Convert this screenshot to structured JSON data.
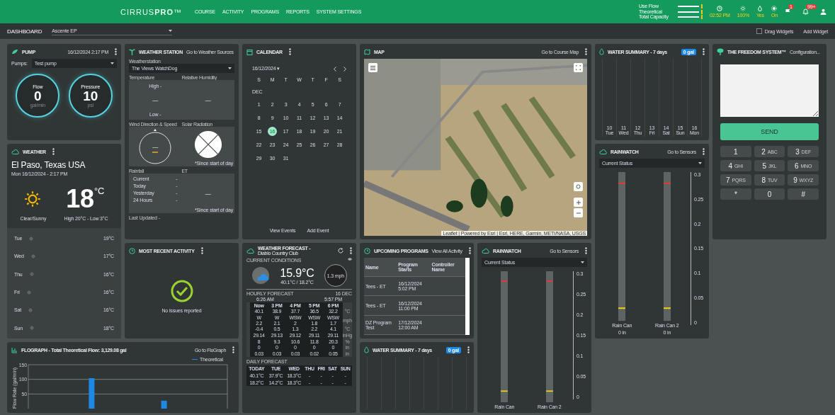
{
  "top_bar": {
    "logo": "CIRRUS**PRO**™",
    "nav": [
      "COURSE",
      "ACTIVITY",
      "PROGRAMS",
      "REPORTS",
      "SYSTEM SETTINGS"
    ],
    "flow_legend": [
      "Use Flow",
      "Theoretical",
      "Total Capacity"
    ],
    "status": [
      {
        "kind": "clock",
        "value": "02:52 PM"
      },
      {
        "kind": "sun",
        "value": "100%"
      },
      {
        "kind": "drop",
        "value": "Yes"
      },
      {
        "kind": "sprinkler",
        "value": "On"
      }
    ],
    "notifications": [
      {
        "kind": "flag",
        "badge": "1"
      },
      {
        "kind": "bell",
        "badge": "99+"
      }
    ]
  },
  "dashboard_bar": {
    "title": "DASHBOARD",
    "site": "Ascente EP",
    "drag_widgets": {
      "label": "Drag Widgets",
      "checked": false
    },
    "add_widget": "Add Widget"
  },
  "pump": {
    "title": "PUMP",
    "timestamp": "16/12/2024 2:17 PM",
    "pumps_label": "Pumps:",
    "pump": "Test pump",
    "gauges": [
      {
        "label": "Flow",
        "value": "0",
        "unit": "gal/min"
      },
      {
        "label": "Pressure",
        "value": "10",
        "unit": "psi"
      }
    ]
  },
  "weather": {
    "title": "WEATHER",
    "city": "El Paso, Texas USA",
    "date": "Mon 16/12/2024 - 2:17 PM",
    "temperature": "18",
    "unit": "°C",
    "condition": "Clear/Sunny",
    "high_low": "High 20°C - Low 3°C",
    "forecast": [
      {
        "day": "Tue",
        "temp": "19°C"
      },
      {
        "day": "Wed",
        "temp": "17°C"
      },
      {
        "day": "Thu",
        "temp": "16°C"
      },
      {
        "day": "Fri",
        "temp": "16°C"
      },
      {
        "day": "Sat",
        "temp": "16°C"
      },
      {
        "day": "Sun",
        "temp": "18°C"
      }
    ]
  },
  "weather_station": {
    "title": "WEATHER STATION",
    "link": "Go to Weather Sources",
    "station_label": "Weatherstation",
    "station": "The Views WatchDog",
    "temperature_label": "Temperature",
    "humidity_label": "Relative Humidity",
    "high": "High -",
    "low": "Low -",
    "temperature": "—",
    "humidity": "—",
    "wind_label": "Wind Direction & Speed",
    "solar_label": "Solar Radiation",
    "wind": "—",
    "solar_note": "*Since start of day",
    "rainfall_label": "Rainfall",
    "et_label": "ET",
    "rainfall": [
      {
        "label": "Current",
        "value": "-"
      },
      {
        "label": "Today",
        "value": "-"
      },
      {
        "label": "Yesterday",
        "value": "-"
      },
      {
        "label": "24 Hours",
        "value": "-"
      }
    ],
    "et": "—",
    "et_note": "*Since start of day",
    "last_updated": "Last Updated -"
  },
  "calendar": {
    "title": "CALENDAR",
    "date": "16/12/2024 ▾",
    "weekdays": [
      "S",
      "M",
      "T",
      "W",
      "T",
      "F",
      "S"
    ],
    "month": "DEC",
    "days": [
      {
        "label": "1",
        "selected": false
      },
      {
        "label": "2",
        "selected": false
      },
      {
        "label": "3",
        "selected": false
      },
      {
        "label": "4",
        "selected": false
      },
      {
        "label": "5",
        "selected": false
      },
      {
        "label": "6",
        "selected": false
      },
      {
        "label": "7",
        "selected": false
      },
      {
        "label": "8",
        "selected": false
      },
      {
        "label": "9",
        "selected": false
      },
      {
        "label": "10",
        "selected": false
      },
      {
        "label": "11",
        "selected": false
      },
      {
        "label": "12",
        "selected": false
      },
      {
        "label": "13",
        "selected": false
      },
      {
        "label": "14",
        "selected": false
      },
      {
        "label": "15",
        "selected": false
      },
      {
        "label": "16",
        "selected": true
      },
      {
        "label": "17",
        "selected": false
      },
      {
        "label": "18",
        "selected": false
      },
      {
        "label": "19",
        "selected": false
      },
      {
        "label": "20",
        "selected": false
      },
      {
        "label": "21",
        "selected": false
      },
      {
        "label": "22",
        "selected": false
      },
      {
        "label": "23",
        "selected": false
      },
      {
        "label": "24",
        "selected": false
      },
      {
        "label": "25",
        "selected": false
      },
      {
        "label": "26",
        "selected": false
      },
      {
        "label": "27",
        "selected": false
      },
      {
        "label": "28",
        "selected": false
      },
      {
        "label": "29",
        "selected": false
      },
      {
        "label": "30",
        "selected": false
      },
      {
        "label": "31",
        "selected": false
      }
    ],
    "buttons": [
      "View Events",
      "Add Event"
    ]
  },
  "map": {
    "title": "MAP",
    "link": "Go to Course Map",
    "attribution": "Leaflet | Powered by Esri | Esri, HERE, Garmin, METI/NASA, USGS"
  },
  "water_summary": {
    "title": "WATER SUMMARY - 7 days",
    "total": "0 gal",
    "days": [
      "10 Tue",
      "11 Wed",
      "12 Thu",
      "13 Fri",
      "14 Sat",
      "15 Sun",
      "16 Mon"
    ]
  },
  "freedom": {
    "title": "THE FREEDOM SYSTEM™",
    "link": "Configuration...",
    "send": "SEND",
    "keys": [
      {
        "digit": "1"
      },
      {
        "digit": "2",
        "letters": "ABC"
      },
      {
        "digit": "3",
        "letters": "DEF"
      },
      {
        "digit": "4",
        "letters": "GHI"
      },
      {
        "digit": "5",
        "letters": "JKL"
      },
      {
        "digit": "6",
        "letters": "MNO"
      },
      {
        "digit": "7",
        "letters": "PQRS"
      },
      {
        "digit": "8",
        "letters": "TUV"
      },
      {
        "digit": "9",
        "letters": "WXYZ"
      },
      {
        "digit": "*"
      },
      {
        "digit": "0"
      },
      {
        "digit": "#"
      }
    ]
  },
  "rainwatch": {
    "title": "RAINWATCH",
    "link": "Go to Sensors",
    "status": "Current Status",
    "ticks": [
      "0.3",
      "0.25",
      "0.2",
      "0.15",
      "0.1",
      "0.05",
      "0"
    ],
    "sensors": [
      {
        "name": "Rain Can",
        "reading": "0 in"
      },
      {
        "name": "Rain Can 2",
        "reading": "0 in"
      }
    ]
  },
  "activity": {
    "title": "MOST RECENT ACTIVITY",
    "message": "No issues reported"
  },
  "forecast": {
    "title": "WEATHER FORECAST -",
    "location": "Diablo Country Club",
    "current_label": "CURRENT CONDITIONS",
    "temperature": "15.9°C",
    "range": "40.1°C / 18.2°C",
    "wind": "1.3 mph",
    "hourly_label": "HOURLY FORECAST",
    "hourly_date": "16 DEC",
    "sunrise": "6:26 AM",
    "sunset": "5:57 PM",
    "hours": [
      "Now",
      "3 PM",
      "4 PM",
      "5 PM",
      "6 PM"
    ],
    "rows": [
      {
        "values": [
          "40.1",
          "38.9",
          "37.7",
          "36.5",
          "32.2"
        ],
        "unit": "°C"
      },
      {
        "values": [
          "W\n2.2",
          "W\n2.1",
          "WSW\n2",
          "WSW\n1.8",
          "WSW\n1.7"
        ],
        "unit": "mph"
      },
      {
        "values": [
          "-0.4",
          "0.5",
          "1.3",
          "2.2",
          "4.1"
        ],
        "unit": "°C"
      },
      {
        "values": [
          "29.14",
          "29.13",
          "29.12",
          "29.11",
          "29.11"
        ],
        "unit": "inHg"
      },
      {
        "values": [
          "8",
          "9.3",
          "10.6",
          "11.8",
          "20.3"
        ],
        "unit": "%"
      },
      {
        "values": [
          "0",
          "0",
          "0",
          "0",
          "0"
        ],
        "unit": "in"
      },
      {
        "values": [
          "0.03",
          "0.03",
          "0.03",
          "0.02",
          "0.05"
        ],
        "unit": "in"
      }
    ],
    "daily_label": "DAILY FORECAST",
    "days": [
      "TODAY",
      "TUE",
      "WED",
      "THU",
      "FRI",
      "SAT",
      "SUN"
    ],
    "highs": [
      "40.1°C",
      "37.9°C",
      "18.3°C",
      "-",
      "-",
      "-",
      "-"
    ],
    "lows": [
      "18.2°C",
      "14.2°C",
      "18.3°C",
      "-",
      "-",
      "-",
      "-"
    ]
  },
  "upcoming": {
    "title": "UPCOMING PROGRAMS",
    "link": "View All Activity",
    "columns": [
      "Name",
      "Program Starts",
      "Controller Name"
    ],
    "rows": [
      [
        "Tees - ET",
        "16/12/2024\n5:02 PM",
        ""
      ],
      [
        "Tees - ET",
        "16/12/2024\n11:00 PM",
        ""
      ],
      [
        "DZ Program Test",
        "17/12/2024\n12:00 AM",
        ""
      ]
    ]
  },
  "water_summary_2": {
    "title": "WATER SUMMARY - 7 days",
    "total": "0 gal"
  },
  "rainwatch_2": {
    "title": "RAINWATCH",
    "link": "Go to Sensors",
    "status": "Current Status",
    "ticks": [
      "0.3",
      "0.25",
      "0.2",
      "0.15",
      "0.1",
      "0.05",
      "0"
    ],
    "sensors": [
      {
        "name": "Rain Can"
      },
      {
        "name": "Rain Can 2"
      }
    ]
  },
  "flograph": {
    "title": "FLOGRAPH - Total Theoretical Flow: 3,129.08 gal",
    "link": "Go to FloGraph",
    "chart_data": {
      "type": "bar",
      "ylabel": "Flow Rate (gal/min)",
      "ylim": [
        0,
        150
      ],
      "yticks": [
        50,
        100,
        150
      ],
      "series": [
        {
          "name": "Theoretical",
          "color": "#1e88e5",
          "values": [
            null,
            null,
            null,
            104,
            null,
            null,
            null,
            27,
            null,
            null,
            null
          ]
        }
      ]
    }
  }
}
